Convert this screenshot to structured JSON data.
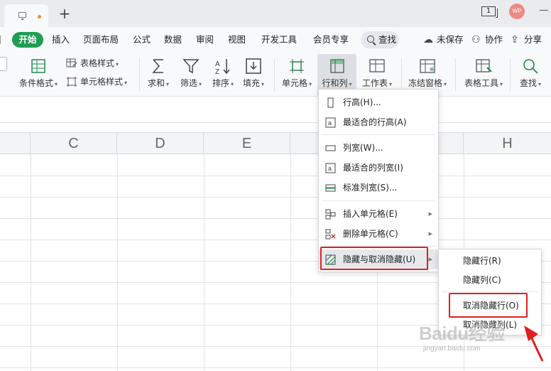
{
  "titlebar": {
    "page_indicator": "1",
    "avatar_initials": "WP"
  },
  "menubar": {
    "start": "开始",
    "items": [
      "插入",
      "页面布局",
      "公式",
      "数据",
      "审阅",
      "视图",
      "开发工具",
      "会员专享"
    ],
    "search": "查找",
    "unsaved": "未保存",
    "collab": "协作",
    "share": "分享"
  },
  "ribbon": {
    "cond_format": "条件格式",
    "table_style": "表格样式",
    "cell_style": "单元格样式",
    "sum": "求和",
    "filter": "筛选",
    "sort": "排序",
    "fill": "填充",
    "cell": "单元格",
    "row_col": "行和列",
    "worksheet": "工作表",
    "freeze": "冻结窗格",
    "table_tools": "表格工具",
    "find": "查找"
  },
  "columns": [
    "C",
    "D",
    "E",
    "H"
  ],
  "context_menu": {
    "row_height": "行高(H)...",
    "best_row_height": "最适合的行高(A)",
    "col_width": "列宽(W)...",
    "best_col_width": "最适合的列宽(I)",
    "std_col_width": "标准列宽(S)...",
    "insert_cells": "插入单元格(E)",
    "delete_cells": "删除单元格(C)",
    "hide_unhide": "隐藏与取消隐藏(U)"
  },
  "submenu": {
    "hide_rows": "隐藏行(R)",
    "hide_cols": "隐藏列(C)",
    "unhide_rows": "取消隐藏行(O)",
    "unhide_cols": "取消隐藏列(L)"
  },
  "watermark": {
    "brand": "Baidu经验",
    "url": "jingyan.baidu.com"
  },
  "colors": {
    "accent_green": "#1f9d55",
    "highlight_red": "#e02020"
  }
}
